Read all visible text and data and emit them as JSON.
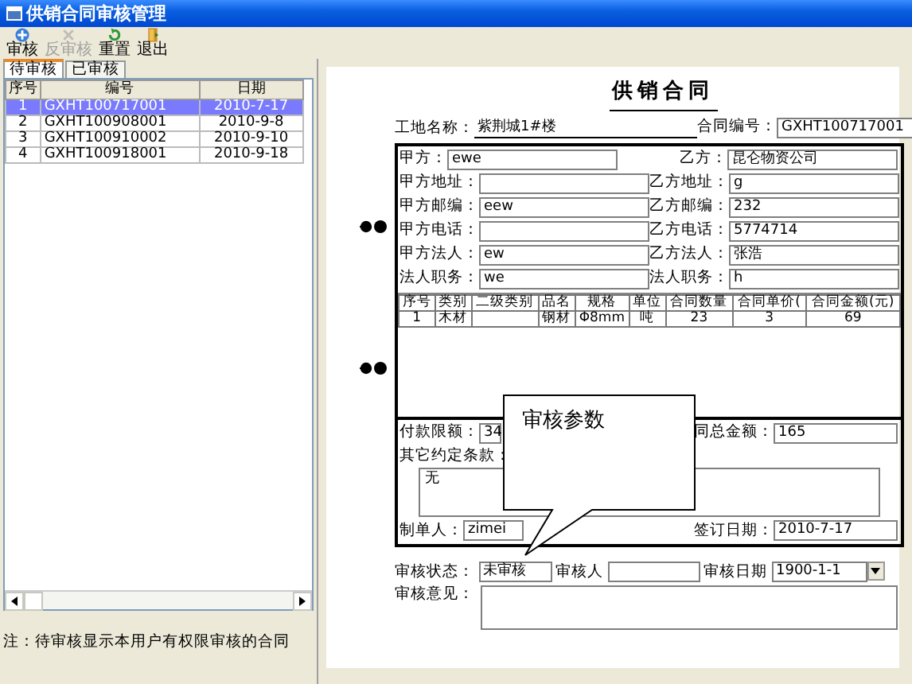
{
  "window": {
    "title": "供销合同审核管理"
  },
  "toolbar": [
    {
      "label": "审核",
      "disabled": false
    },
    {
      "label": "反审核",
      "disabled": true
    },
    {
      "label": "重置",
      "disabled": false
    },
    {
      "label": "退出",
      "disabled": false
    }
  ],
  "tabs": [
    {
      "label": "待审核",
      "selected": true
    },
    {
      "label": "已审核",
      "selected": false
    }
  ],
  "list": {
    "columns": [
      "序号",
      "编号",
      "日期"
    ],
    "rows": [
      {
        "cells": [
          "1",
          "GXHT100717001",
          "2010-7-17"
        ],
        "selected": true
      },
      {
        "cells": [
          "2",
          "GXHT100908001",
          "2010-9-8"
        ],
        "selected": false
      },
      {
        "cells": [
          "3",
          "GXHT100910002",
          "2010-9-10"
        ],
        "selected": false
      },
      {
        "cells": [
          "4",
          "GXHT100918001",
          "2010-9-18"
        ],
        "selected": false
      }
    ]
  },
  "note": "注：待审核显示本用户有权限审核的合同",
  "form": {
    "title": "供销合同",
    "site": {
      "label": "工地名称：",
      "value": "紫荆城1#楼"
    },
    "contract_no": {
      "label": "合同编号：",
      "value": "GXHT100717001"
    },
    "parties": [
      {
        "left": {
          "label": "甲方：",
          "value": "ewe"
        },
        "right": {
          "label": "乙方：",
          "value": "昆仑物资公司"
        }
      },
      {
        "left": {
          "label": "甲方地址："
        },
        "right": {
          "label": "乙方地址：",
          "value": "g"
        }
      },
      {
        "left": {
          "label": "甲方邮编：",
          "value": "eew"
        },
        "right": {
          "label": "乙方邮编：",
          "value": "232"
        }
      },
      {
        "left": {
          "label": "甲方电话："
        },
        "right": {
          "label": "乙方电话：",
          "value": "5774714"
        }
      },
      {
        "left": {
          "label": "甲方法人：",
          "value": "ew"
        },
        "right": {
          "label": "乙方法人：",
          "value": "张浩"
        }
      },
      {
        "left": {
          "label": "法人职务：",
          "value": "we"
        },
        "right": {
          "label": "法人职务：",
          "value": "h"
        }
      }
    ],
    "items": {
      "columns": [
        "序号",
        "类别",
        "二级类别",
        "品名",
        "规格",
        "单位",
        "合同数量",
        "合同单价(",
        "合同金额(元)"
      ],
      "rows": [
        [
          "1",
          "木材",
          null,
          "钢材",
          "Φ8mm",
          "吨",
          "23",
          "3",
          "69"
        ]
      ]
    },
    "payment_limit": {
      "label": "付款限额：",
      "value": "34"
    },
    "total": {
      "label": "同总金额：",
      "value": "165"
    },
    "other_terms": {
      "label": "其它约定条款：",
      "value": "无"
    },
    "maker": {
      "label": "制单人：",
      "value": "zimei"
    },
    "sign_date": {
      "label": "签订日期：",
      "value": "2010-7-17"
    }
  },
  "audit": {
    "status": {
      "label": "审核状态：",
      "value": "未审核"
    },
    "auditor": {
      "label": "审核人"
    },
    "date": {
      "label": "审核日期",
      "value": "1900-1-1"
    },
    "opinion": {
      "label": "审核意见："
    }
  },
  "callout": {
    "text": "审核参数"
  }
}
